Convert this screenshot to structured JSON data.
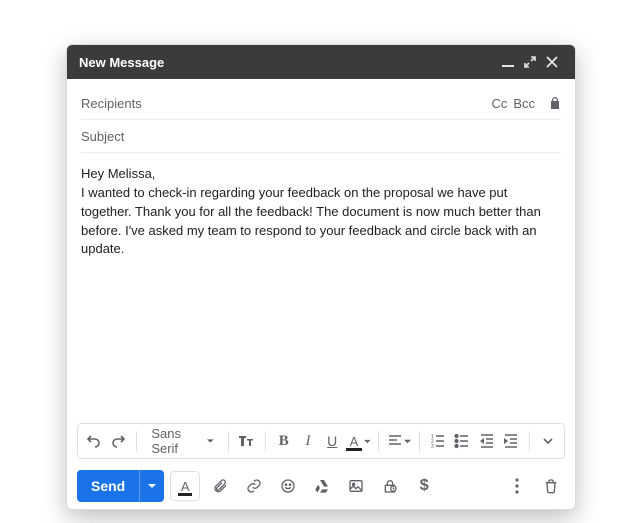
{
  "titlebar": {
    "title": "New Message"
  },
  "fields": {
    "recipients_placeholder": "Recipients",
    "cc_label": "Cc",
    "bcc_label": "Bcc",
    "subject_placeholder": "Subject"
  },
  "body": {
    "greeting": "Hey Melissa,",
    "paragraph": "I wanted to check-in regarding your feedback on the proposal we have put together. Thank you for all the feedback! The document is now much better than before. I've asked my team to respond to your feedback and circle back with an update."
  },
  "format": {
    "font_label": "Sans Serif",
    "bold": "B",
    "italic": "I",
    "underline": "U",
    "text_color": "A"
  },
  "actions": {
    "send_label": "Send",
    "money": "$"
  }
}
